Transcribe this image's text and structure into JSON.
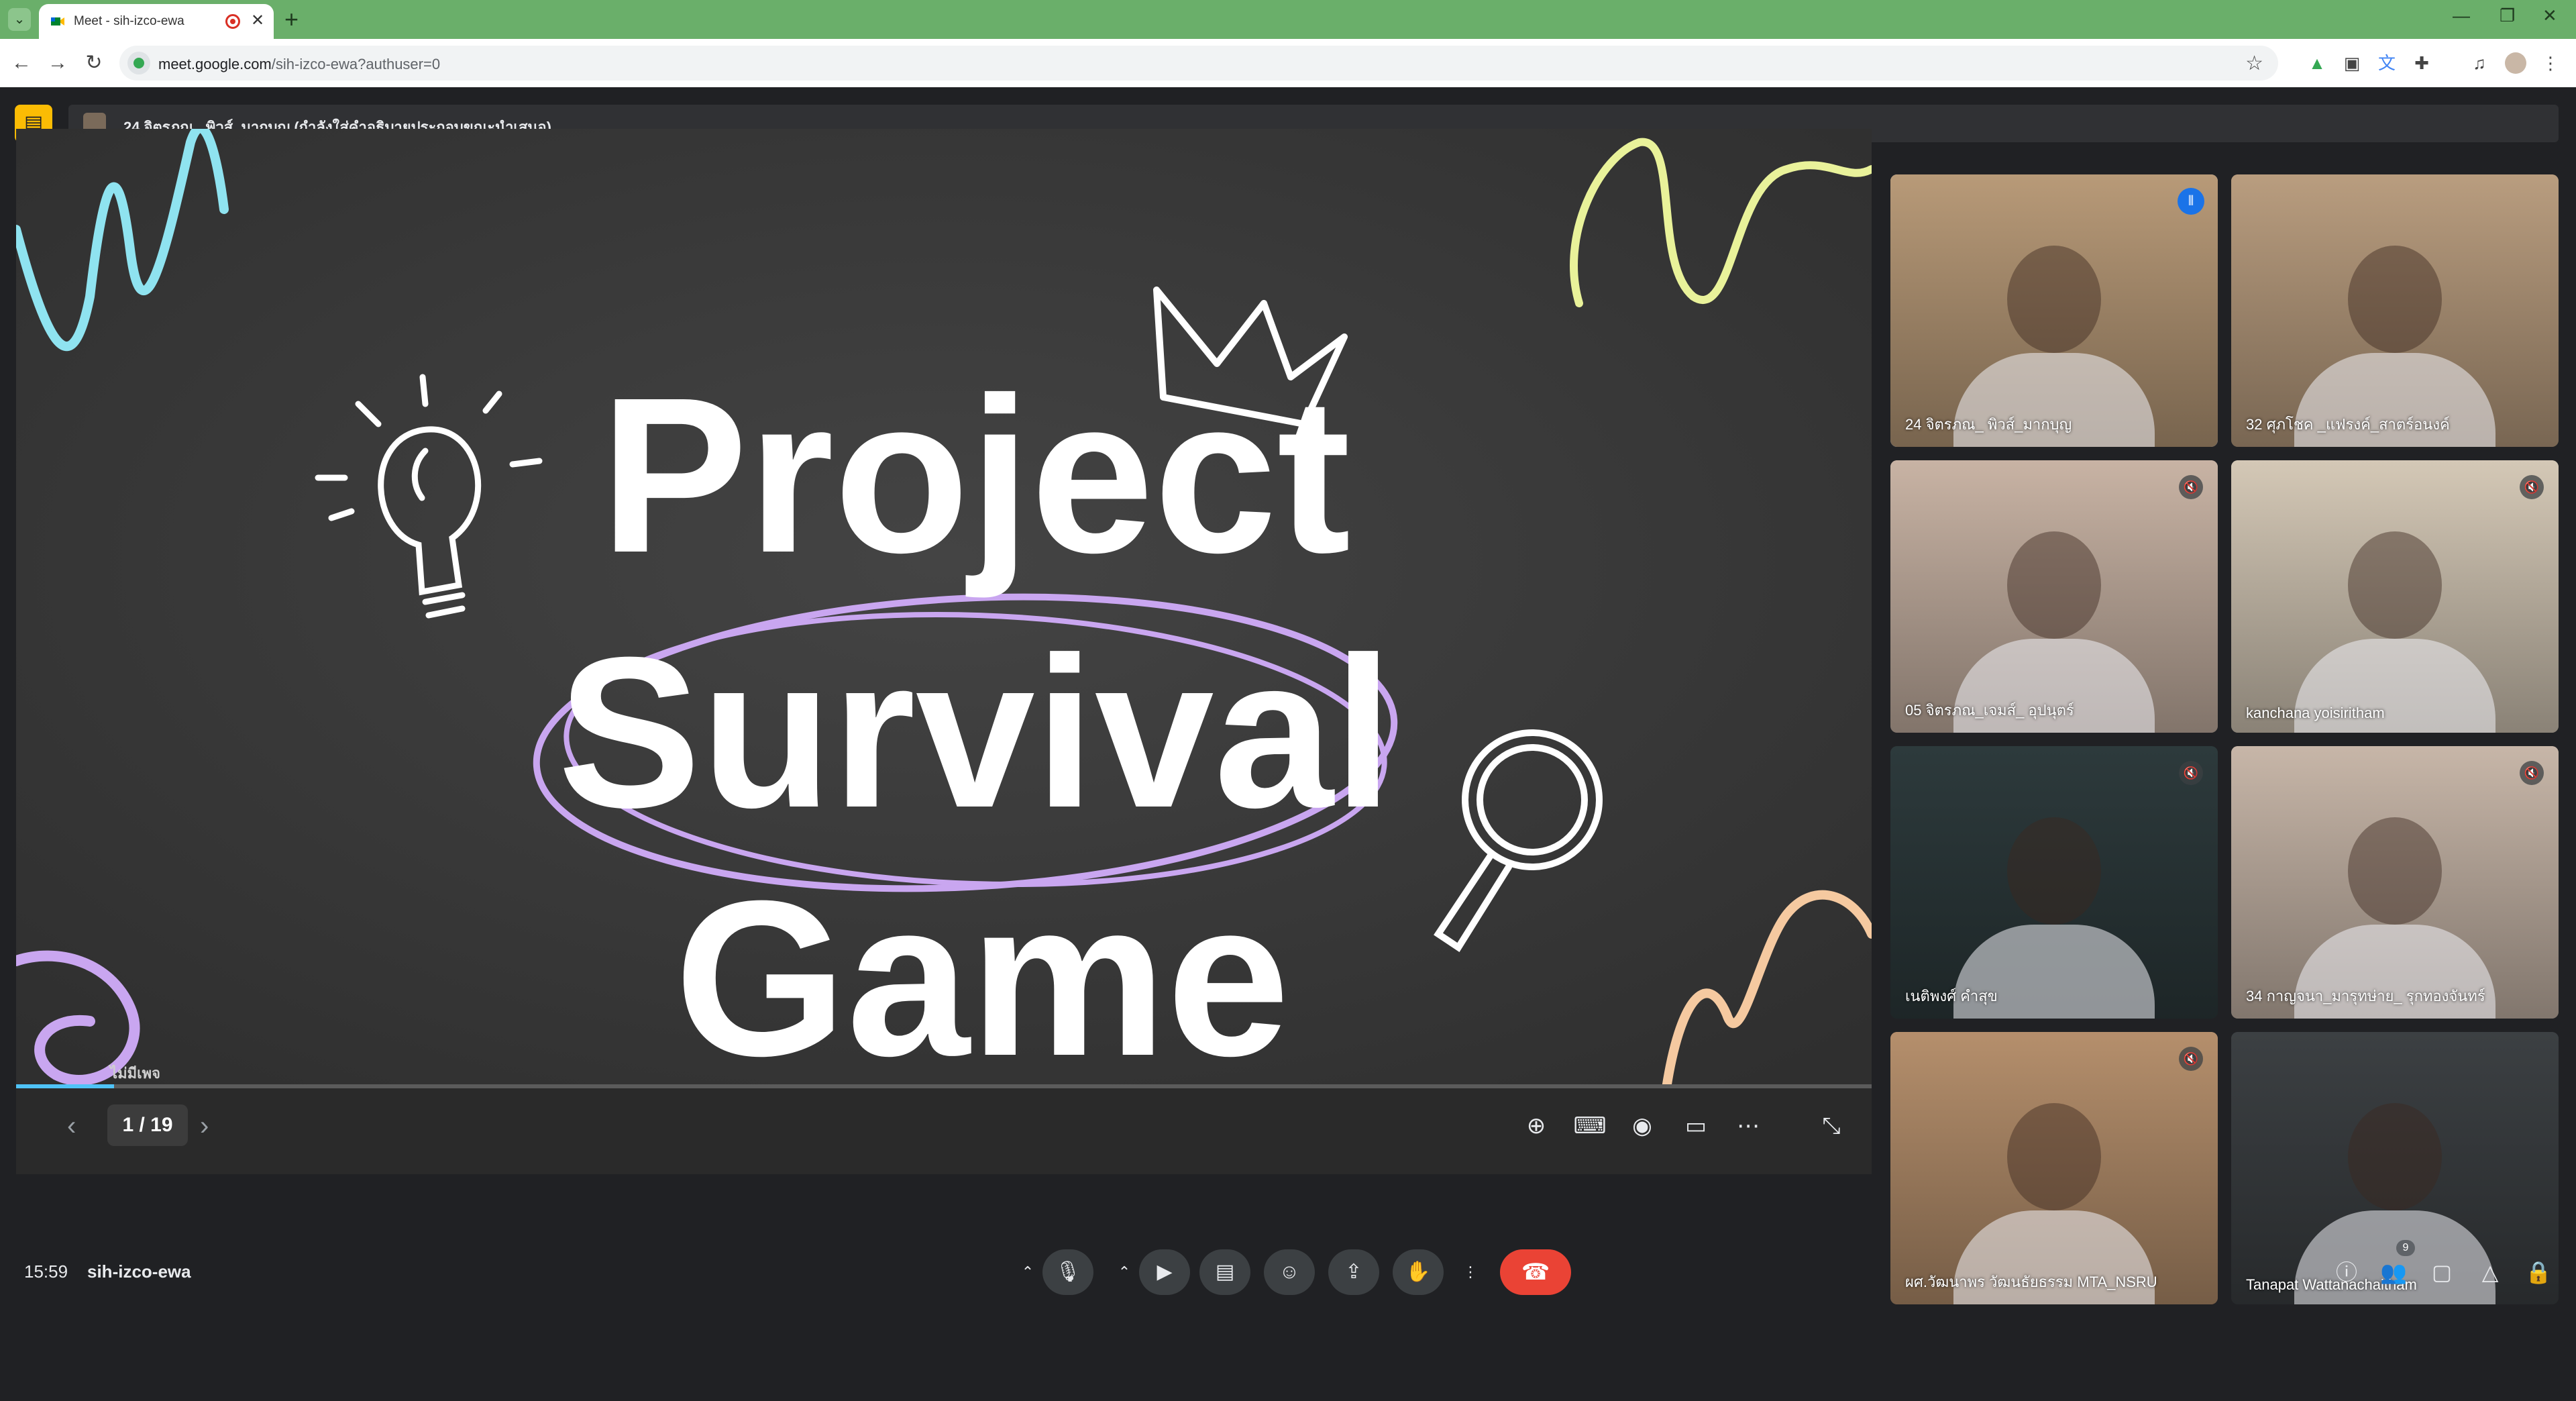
{
  "browser": {
    "tab_title": "Meet - sih-izco-ewa",
    "url_host": "meet.google.com",
    "url_path": "/sih-izco-ewa?authuser=0",
    "win_min": "—",
    "win_restore": "❐",
    "win_close": "✕"
  },
  "presenter": {
    "text": "24 จิตรภณ_ พิวส์_มากบุญ (กำลังใส่คำอธิบายประกอบขณะนำเสนอ)"
  },
  "slide": {
    "title_lines": [
      "Project",
      "Survival",
      "Game"
    ],
    "page_label": "ไม่มีเพจ",
    "current_page": 1,
    "total_pages": 19,
    "page_display": "1 / 19",
    "colors": {
      "board": "#3a3a3a",
      "chalk_white": "#ffffff",
      "lilac": "#c9a6f0",
      "cyan": "#8fe3f0",
      "yellow": "#e9f29a",
      "peach": "#f5c9a0"
    }
  },
  "participants": [
    {
      "name": "24 จิตรภณ_ พิวส์_มากบุญ",
      "state": "speaking",
      "bg": "#b89a78"
    },
    {
      "name": "32 ศุภโชค _แฟรงค์_สาตร์อนงค์",
      "state": "none",
      "bg": "#b99d7f"
    },
    {
      "name": "05 จิตรภณ_เจมส์_ อุปนุตร์",
      "state": "muted",
      "bg": "#c8b3a4"
    },
    {
      "name": "kanchana yoisiritham",
      "state": "muted",
      "bg": "#d4c8b6"
    },
    {
      "name": "เนติพงศ์ คำสุข",
      "state": "muted",
      "bg": "#2d3a3c"
    },
    {
      "name": "34 กาญจนา_มารุทษ่าย_ รุกทองจันทร์",
      "state": "muted",
      "bg": "#c7b6a8"
    },
    {
      "name": "ผศ.วัฒนาพร วัฒนธัยธรรม MTA_NSRU",
      "state": "muted",
      "bg": "#b58f6c"
    },
    {
      "name": "Tanapat Wattanachaitham",
      "state": "none",
      "bg": "#3c4043"
    }
  ],
  "bottom": {
    "time": "15:59",
    "meeting_code": "sih-izco-ewa",
    "participant_count": "9"
  },
  "icons": {
    "mic": "🎙",
    "cam": "▶",
    "captions": "▤",
    "emoji": "☺",
    "present": "⇪",
    "hand": "✋",
    "more": "⋮",
    "end": "☎",
    "info": "ⓘ",
    "people": "👥",
    "chat": "▢",
    "activities": "△",
    "lock": "🔒"
  }
}
